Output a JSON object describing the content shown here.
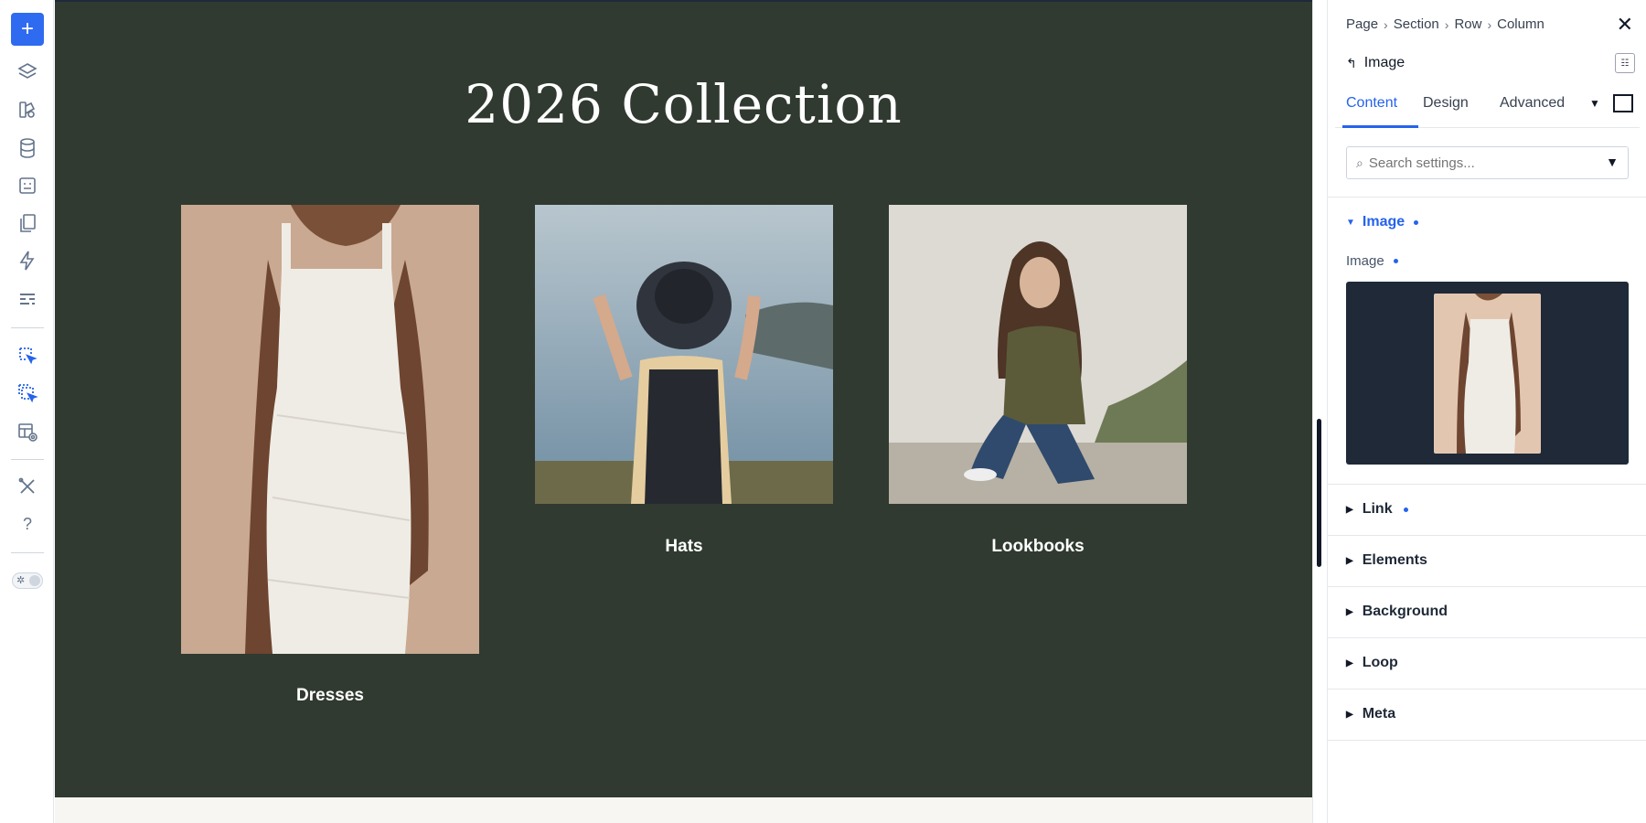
{
  "toolbar": {
    "add_label": "+",
    "help_label": "?"
  },
  "canvas": {
    "title": "2026 Collection",
    "background": "#303a30",
    "cards": [
      {
        "label": "Dresses"
      },
      {
        "label": "Hats"
      },
      {
        "label": "Lookbooks"
      }
    ]
  },
  "panel": {
    "breadcrumb": [
      "Page",
      "Section",
      "Row",
      "Column"
    ],
    "element_title": "Image",
    "tabs": [
      "Content",
      "Design",
      "Advanced"
    ],
    "active_tab": "Content",
    "search_placeholder": "Search settings...",
    "open_section": "Image",
    "field_label": "Image",
    "sections": [
      "Link",
      "Elements",
      "Background",
      "Loop",
      "Meta"
    ],
    "accent_color": "#2563eb"
  }
}
